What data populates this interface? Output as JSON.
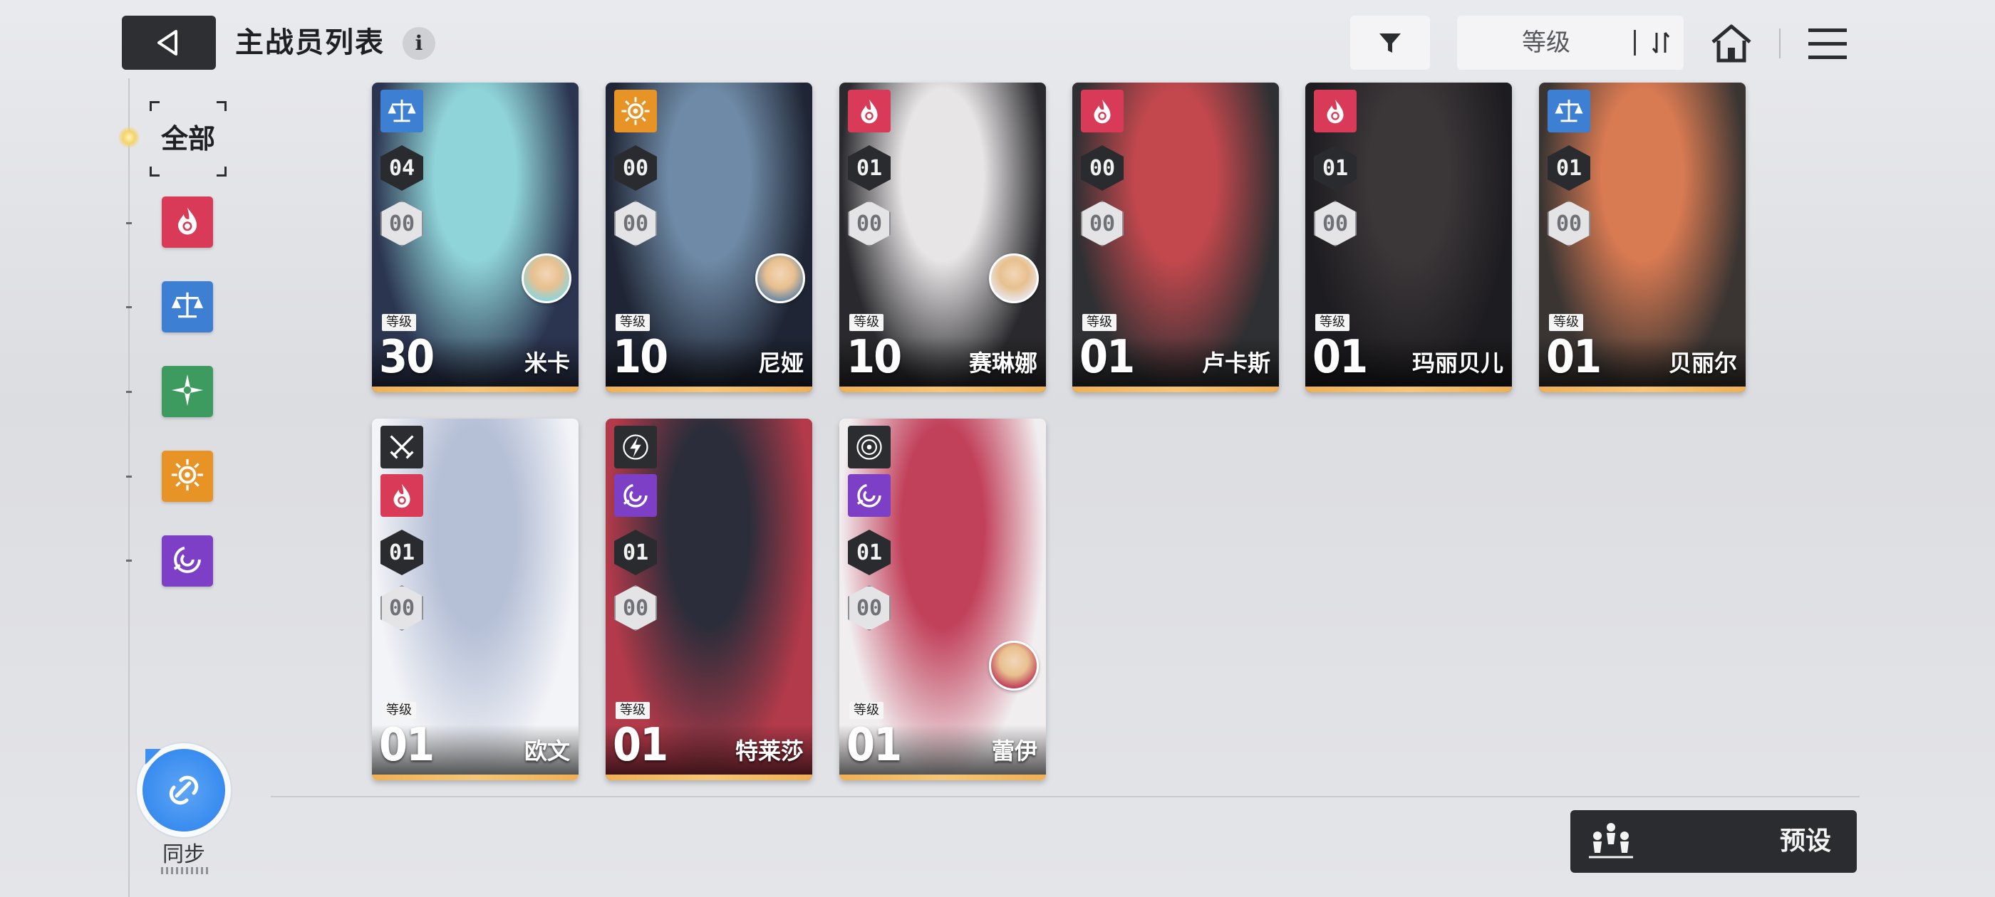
{
  "header": {
    "title": "主战员列表",
    "info_icon": "i",
    "sort_label": "等级"
  },
  "sidebar": {
    "all_label": "全部",
    "filters": [
      {
        "name": "burn",
        "color": "#d93a57",
        "icon": "flame-icon"
      },
      {
        "name": "balance",
        "color": "#3c7fd3",
        "icon": "scales-icon"
      },
      {
        "name": "wind",
        "color": "#3e9b5f",
        "icon": "star-burst-icon"
      },
      {
        "name": "sun",
        "color": "#e79326",
        "icon": "sun-icon"
      },
      {
        "name": "void",
        "color": "#7c3fc6",
        "icon": "spiral-icon"
      }
    ],
    "sync_label": "同步"
  },
  "level_tag": "等级",
  "characters": [
    {
      "name": "米卡",
      "level": "30",
      "upper": "04",
      "lower": "00",
      "element": "balance",
      "element_color": "#3c7fd3",
      "avatar": true,
      "art": [
        "#8fd4d8",
        "#2c3550"
      ]
    },
    {
      "name": "尼娅",
      "level": "10",
      "upper": "00",
      "lower": "00",
      "element": "sun",
      "element_color": "#e79326",
      "avatar": true,
      "art": [
        "#6f8aa6",
        "#1f2534"
      ]
    },
    {
      "name": "赛琳娜",
      "level": "10",
      "upper": "01",
      "lower": "00",
      "element": "burn",
      "element_color": "#d93a57",
      "avatar": true,
      "art": [
        "#e8e5e6",
        "#2a2a2e"
      ]
    },
    {
      "name": "卢卡斯",
      "level": "01",
      "upper": "00",
      "lower": "00",
      "element": "burn",
      "element_color": "#d93a57",
      "avatar": false,
      "art": [
        "#c2484d",
        "#2f3033"
      ]
    },
    {
      "name": "玛丽贝儿",
      "level": "01",
      "upper": "01",
      "lower": "00",
      "element": "burn",
      "element_color": "#d93a57",
      "avatar": false,
      "art": [
        "#3b3638",
        "#1d1c20"
      ]
    },
    {
      "name": "贝丽尔",
      "level": "01",
      "upper": "01",
      "lower": "00",
      "element": "balance",
      "element_color": "#3c7fd3",
      "avatar": false,
      "art": [
        "#d87a52",
        "#3a3533"
      ]
    },
    {
      "name": "欧文",
      "level": "01",
      "upper": "01",
      "lower": "00",
      "element": "burn",
      "element_color": "#d93a57",
      "role": "swords-icon",
      "avatar": false,
      "art": [
        "#b5bfd6",
        "#f3f4f7"
      ]
    },
    {
      "name": "特莱莎",
      "level": "01",
      "upper": "01",
      "lower": "00",
      "element": "void",
      "element_color": "#7c3fc6",
      "role": "lightning-icon",
      "avatar": false,
      "art": [
        "#2c2d3a",
        "#b23a4a"
      ]
    },
    {
      "name": "蕾伊",
      "level": "01",
      "upper": "01",
      "lower": "00",
      "element": "void",
      "element_color": "#7c3fc6",
      "role": "target-icon",
      "avatar": true,
      "art": [
        "#c1405a",
        "#f1eef0"
      ]
    }
  ],
  "footer": {
    "preset_label": "预设"
  }
}
